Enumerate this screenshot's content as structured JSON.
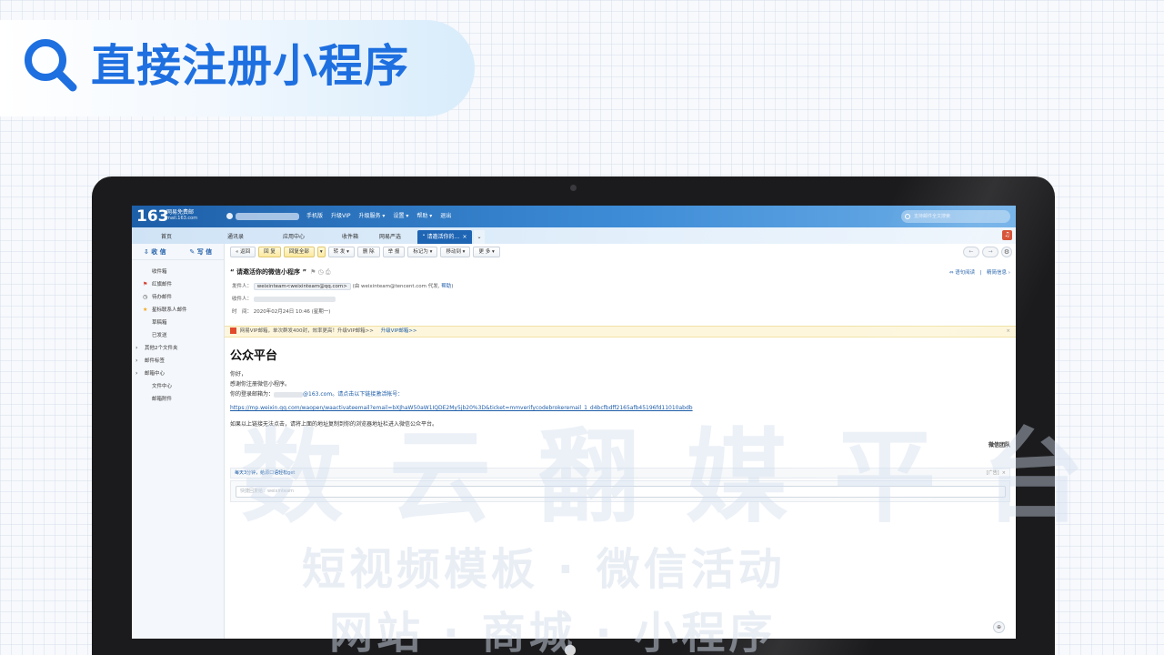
{
  "slide": {
    "title": "直接注册小程序",
    "accent_color": "#1e6fe0",
    "icon": "search-icon"
  },
  "mail_app": {
    "logo": {
      "number": "163",
      "name": "网易免费邮",
      "domain": "mail.163.com"
    },
    "top_menu": [
      "手机版",
      "升级VIP",
      "升级服务 ▾",
      "设置 ▾",
      "帮助 ▾",
      "退出"
    ],
    "search_placeholder": "支持邮件全文搜索",
    "tabs": [
      {
        "label": "首页"
      },
      {
        "label": "通讯录"
      },
      {
        "label": "应用中心"
      },
      {
        "label": "收件箱"
      },
      {
        "label": "网易严选"
      },
      {
        "label": "“ 请邀活你的…",
        "close": "×"
      }
    ],
    "sidebar": {
      "receive_label": "收 信",
      "write_label": "写 信",
      "items": [
        {
          "icon": "",
          "label": "收件箱"
        },
        {
          "icon": "flag-icon",
          "glyph": "⚑",
          "label": "红旗邮件"
        },
        {
          "icon": "clock-icon",
          "glyph": "◷",
          "label": "待办邮件"
        },
        {
          "icon": "star-icon",
          "glyph": "★",
          "label": "星标联系人邮件"
        },
        {
          "icon": "",
          "label": "草稿箱"
        },
        {
          "icon": "",
          "label": "已发送"
        },
        {
          "icon": "chevron-right-icon",
          "glyph": "›",
          "label": "其他2个文件夹"
        },
        {
          "icon": "chevron-right-icon",
          "glyph": "›",
          "label": "邮件标签"
        },
        {
          "icon": "chevron-right-icon",
          "glyph": "›",
          "label": "邮箱中心"
        },
        {
          "icon": "",
          "label": "文件中心"
        },
        {
          "icon": "",
          "label": "邮箱附件"
        }
      ]
    },
    "toolbar": {
      "back": "« 返回",
      "reply": "回 复",
      "reply_all": "回复全部",
      "reply_all_arrow": "▾",
      "forward": "转 发 ▾",
      "delete": "删 除",
      "report": "举 报",
      "mark_as": "标记为 ▾",
      "move_to": "移动到 ▾",
      "more": "更 多 ▾",
      "prev": "←",
      "next": "→",
      "gear": "⚙"
    },
    "mail": {
      "subject": "“ 请邀活你的微信小程序 ”",
      "subject_icons": "⚑ ◷ ⎙",
      "header_right": "⇔ 语句阅读　|　精简信息 ›",
      "from_label": "发件人：",
      "from_sender": "weixinteam<weixinteam@qq.com>",
      "from_extra": "(由 weixinteam@tencent.com 代发",
      "from_help": "帮助",
      "to_label": "收件人：",
      "time_label": "时　间：",
      "time_value": "2020年02月24日 10:46 (星期一)",
      "vip_banner_text": "网易VIP邮箱，单次群发400封，效率更高！升级VIP邮箱>>",
      "vip_banner_link": "升级VIP邮箱>>",
      "vip_close": "×",
      "brand": "公众平台",
      "greeting": "你好，",
      "thanks": "感谢你注册微信小程序。",
      "login_prefix": "你的登录邮箱为：",
      "login_suffix": "@163.com。请点击以下链接激活帐号：",
      "activation_url": "https://mp.weixin.qq.com/waopen/waactivateemail?email=bXJhaW50aW1IQDE2My5jb20%3D&ticket=mmverifycodebrokeremail_1_d4bcfbdff2165afb45196fd11010abdb",
      "note": "如果以上链接无法点击，请将上面的地址复制到你的浏览器地址栏进入微信公众平台。",
      "signature": "微信团队"
    },
    "ad_bar": {
      "text": "每天3分钟，给源口语轻松get",
      "tag": "[广告]",
      "close": "×"
    },
    "reply_placeholder": "快捷回复给：weixinteam",
    "zoom_icon": "⊕"
  },
  "watermark": {
    "line1": "数 云 翻 媒 平 台",
    "line2": "短视频模板 · 微信活动",
    "line3": "网站 · 商城 · 小程序"
  }
}
